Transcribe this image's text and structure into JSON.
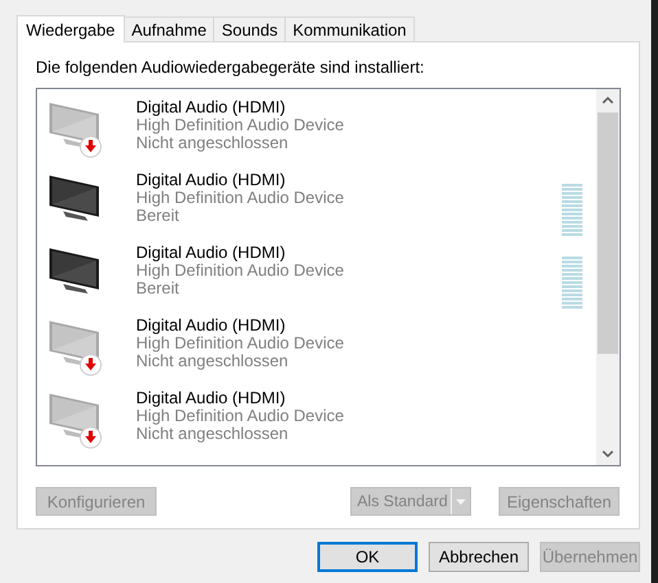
{
  "tabs": [
    {
      "label": "Wiedergabe",
      "selected": true
    },
    {
      "label": "Aufnahme",
      "selected": false
    },
    {
      "label": "Sounds",
      "selected": false
    },
    {
      "label": "Kommunikation",
      "selected": false
    }
  ],
  "intro": "Die folgenden Audiowiedergabegeräte sind installiert:",
  "devices": [
    {
      "name": "Digital Audio (HDMI)",
      "driver": "High Definition Audio Device",
      "status": "Nicht angeschlossen",
      "connected": false
    },
    {
      "name": "Digital Audio (HDMI)",
      "driver": "High Definition Audio Device",
      "status": "Bereit",
      "connected": true
    },
    {
      "name": "Digital Audio (HDMI)",
      "driver": "High Definition Audio Device",
      "status": "Bereit",
      "connected": true
    },
    {
      "name": "Digital Audio (HDMI)",
      "driver": "High Definition Audio Device",
      "status": "Nicht angeschlossen",
      "connected": false
    },
    {
      "name": "Digital Audio (HDMI)",
      "driver": "High Definition Audio Device",
      "status": "Nicht angeschlossen",
      "connected": false
    }
  ],
  "panel_buttons": [
    {
      "label": "Konfigurieren",
      "disabled": true,
      "kind": "plain"
    },
    {
      "label": "Als Standard",
      "disabled": true,
      "kind": "split"
    },
    {
      "label": "Eigenschaften",
      "disabled": true,
      "kind": "plain"
    }
  ],
  "dialog_buttons": [
    {
      "label": "OK",
      "disabled": false,
      "focused": true
    },
    {
      "label": "Abbrechen",
      "disabled": false,
      "focused": false
    },
    {
      "label": "Übernehmen",
      "disabled": true,
      "focused": false
    }
  ]
}
